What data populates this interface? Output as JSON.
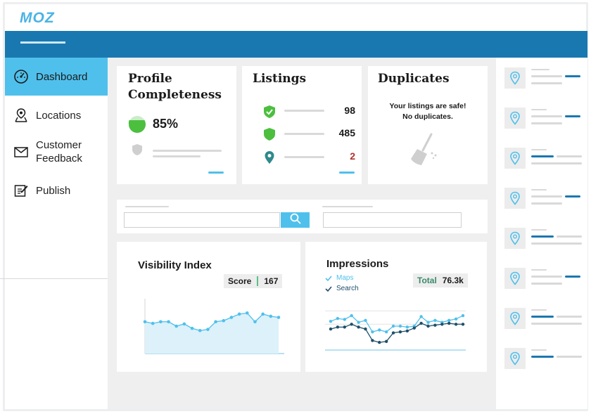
{
  "brand": {
    "logo": "MOZ",
    "accent": "#4fc0ec",
    "topbar_color": "#1a78b0"
  },
  "sidebar": {
    "items": [
      {
        "label": "Dashboard",
        "icon": "dashboard-gauge-icon",
        "active": true
      },
      {
        "label": "Locations",
        "icon": "map-pin-icon",
        "active": false
      },
      {
        "label": "Customer Feedback",
        "icon": "envelope-icon",
        "active": false
      },
      {
        "label": "Publish",
        "icon": "edit-icon",
        "active": false
      }
    ]
  },
  "profile": {
    "title_line1": "Profile",
    "title_line2": "Completeness",
    "percent": "85%",
    "progress": 0.85
  },
  "listings": {
    "title": "Listings",
    "rows": [
      {
        "icon": "shield-check-icon",
        "value": "98",
        "color": "#1b1b1b"
      },
      {
        "icon": "shield-icon",
        "value": "485",
        "color": "#1b1b1b"
      },
      {
        "icon": "location-pin-icon",
        "value": "2",
        "color": "#b3312c"
      }
    ]
  },
  "duplicates": {
    "title": "Duplicates",
    "message_line1": "Your listings are safe!",
    "message_line2": "No duplicates."
  },
  "visibility": {
    "title": "Visibility Index",
    "score_label": "Score",
    "score_value": "167"
  },
  "impressions": {
    "title": "Impressions",
    "legend": [
      {
        "label": "Maps",
        "color": "#4fc0ec"
      },
      {
        "label": "Search",
        "color": "#1f4f6b"
      }
    ],
    "total_label": "Total",
    "total_value": "76.3k"
  },
  "chart_data": [
    {
      "type": "area",
      "title": "Visibility Index",
      "x": [
        1,
        2,
        3,
        4,
        5,
        6,
        7,
        8,
        9,
        10,
        11,
        12,
        13,
        14,
        15,
        16,
        17,
        18
      ],
      "series": [
        {
          "name": "Score",
          "values": [
            58,
            55,
            58,
            58,
            50,
            54,
            46,
            42,
            44,
            58,
            60,
            66,
            72,
            74,
            58,
            72,
            68,
            66
          ]
        }
      ],
      "ylim": [
        0,
        100
      ]
    },
    {
      "type": "line",
      "title": "Impressions",
      "x": [
        1,
        2,
        3,
        4,
        5,
        6,
        7,
        8,
        9,
        10,
        11,
        12,
        13,
        14,
        15,
        16,
        17,
        18,
        19,
        20
      ],
      "series": [
        {
          "name": "Maps",
          "values": [
            60,
            66,
            64,
            72,
            58,
            62,
            38,
            42,
            38,
            50,
            50,
            48,
            50,
            70,
            58,
            62,
            58,
            62,
            65,
            72
          ]
        },
        {
          "name": "Search",
          "values": [
            44,
            48,
            48,
            54,
            48,
            44,
            20,
            16,
            18,
            36,
            38,
            40,
            46,
            56,
            50,
            52,
            54,
            56,
            54,
            54
          ]
        }
      ],
      "ylim": [
        0,
        100
      ]
    }
  ]
}
